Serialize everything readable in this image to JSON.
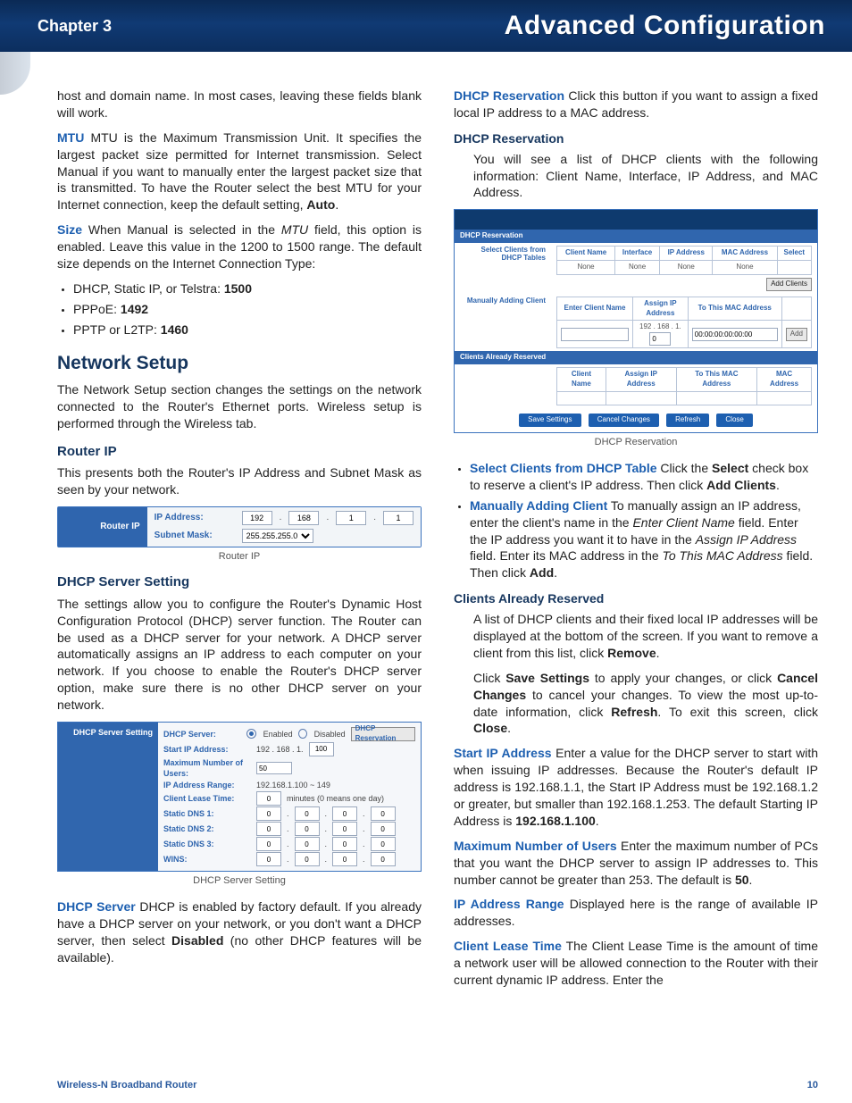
{
  "header": {
    "chapter": "Chapter 3",
    "title": "Advanced Configuration"
  },
  "footer": {
    "left": "Wireless-N Broadband Router",
    "right": "10"
  },
  "p_intro": "host and domain name. In most cases, leaving these fields blank will work.",
  "mtu_term": "MTU",
  "mtu_span_1": " MTU is the Maximum Transmission Unit. It specifies the largest packet size permitted for Internet transmission. Select Manual if you want to manually enter the largest packet size that is transmitted. To have the Router select the best MTU for your Internet connection, keep the default setting, ",
  "mtu_bold_tail": "Auto",
  "mtu_tail": ".",
  "size_term": "Size",
  "size_span_1": " When Manual is selected in the ",
  "size_ital": "MTU",
  "size_span_2": " field, this option is enabled. Leave this value in the 1200 to 1500 range. The default size depends on the Internet Connection Type:",
  "size_list": [
    {
      "pre": "DHCP, Static IP, or Telstra: ",
      "val": "1500"
    },
    {
      "pre": "PPPoE: ",
      "val": "1492"
    },
    {
      "pre": "PPTP or L2TP: ",
      "val": "1460"
    }
  ],
  "sec_network_setup": "Network Setup",
  "ns_intro": "The Network Setup section changes the settings on the network connected to the Router's Ethernet ports. Wireless setup is performed through the Wireless tab.",
  "sub_routerip": "Router IP",
  "routerip_text": "This presents both the Router's IP Address and Subnet Mask as seen by your network.",
  "fig_routerip": {
    "side": "Router IP",
    "ip_label": "IP Address:",
    "ip": [
      "192",
      "168",
      "1",
      "1"
    ],
    "mask_label": "Subnet Mask:",
    "mask": "255.255.255.0",
    "caption": "Router IP"
  },
  "sub_dhcp_setting": "DHCP Server Setting",
  "dhcp_setting_text": "The settings allow you to configure the Router's Dynamic Host Configuration Protocol (DHCP) server function. The Router can be used as a DHCP server for your network. A DHCP server automatically assigns an IP address to each computer on your network. If you choose to enable the Router's DHCP server option, make sure there is no other DHCP server on your network.",
  "fig_dhcp": {
    "side": "DHCP Server Setting",
    "labels": {
      "server": "DHCP Server:",
      "enabled": "Enabled",
      "disabled": "Disabled",
      "reservation_btn": "DHCP Reservation",
      "start_ip": "Start IP Address:",
      "start_ip_prefix": "192 . 168 . 1.",
      "start_ip_val": "100",
      "max_users": "Maximum Number of Users:",
      "max_users_val": "50",
      "range": "IP Address Range:",
      "range_val": "192.168.1.100 ~ 149",
      "lease": "Client Lease Time:",
      "lease_val": "0",
      "lease_hint": "minutes (0 means one day)",
      "dns1": "Static DNS 1:",
      "dns2": "Static DNS 2:",
      "dns3": "Static DNS 3:",
      "wins": "WINS:"
    },
    "caption": "DHCP Server Setting"
  },
  "dhcp_server_term": "DHCP Server",
  "dhcp_server_span_1": " DHCP is enabled by factory default. If you already have a DHCP server on your network, or you don't want a DHCP server, then select ",
  "dhcp_server_bold": "Disabled",
  "dhcp_server_span_2": " (no other DHCP features will be available).",
  "dhcp_res_term": "DHCP Reservation",
  "dhcp_res_text": " Click this button if you want to assign a fixed local IP address to a MAC address.",
  "sub_dhcp_reservation": "DHCP Reservation",
  "dhcp_reservation_intro": "You will see a list of DHCP clients with the following information: Client Name, Interface, IP Address, and MAC Address.",
  "fig_res": {
    "strip": "DHCP Reservation",
    "side1": "Select Clients from DHCP Tables",
    "th": [
      "Client Name",
      "Interface",
      "IP Address",
      "MAC Address",
      "Select"
    ],
    "td_none": "None",
    "add_clients": "Add Clients",
    "side2": "Manually Adding Client",
    "man_th": [
      "Enter Client Name",
      "Assign IP Address",
      "To This MAC Address"
    ],
    "man_ip_prefix": "192 . 168 . 1.",
    "man_ip_val": "0",
    "man_mac": "00:00:00:00:00:00",
    "add_btn": "Add",
    "side3_strip": "Clients Already Reserved",
    "res_th": [
      "Client Name",
      "Assign IP Address",
      "To This MAC Address",
      "MAC Address"
    ],
    "buttons": [
      "Save Settings",
      "Cancel Changes",
      "Refresh",
      "Close"
    ],
    "caption": "DHCP Reservation"
  },
  "bl_select_term": "Select Clients from DHCP Table",
  "bl_select_1": " Click the ",
  "bl_select_bold1": "Select",
  "bl_select_2": " check box to reserve a client's IP address. Then click ",
  "bl_select_bold2": "Add Clients",
  "bl_select_3": ".",
  "bl_manual_term": "Manually Adding Client",
  "bl_manual_1": " To manually assign an IP address, enter the client's name in the ",
  "bl_manual_i1": "Enter Client Name",
  "bl_manual_2": " field. Enter the IP address you want it to have in the ",
  "bl_manual_i2": "Assign IP Address",
  "bl_manual_3": " field. Enter its MAC address in the ",
  "bl_manual_i3": "To This MAC Address",
  "bl_manual_4": " field. Then click ",
  "bl_manual_bold": "Add",
  "bl_manual_5": ".",
  "sub_clients_reserved": "Clients Already Reserved",
  "car_p1_a": "A list of DHCP clients and their fixed local IP addresses will be displayed at the bottom of the screen. If you want to remove a client from this list, click ",
  "car_p1_b": "Remove",
  "car_p1_c": ".",
  "car_p2_a": "Click ",
  "car_p2_b": "Save Settings",
  "car_p2_c": " to apply your changes, or click ",
  "car_p2_d": "Cancel Changes",
  "car_p2_e": " to cancel your changes. To view the most up-to-date information, click ",
  "car_p2_f": "Refresh",
  "car_p2_g": ". To exit this screen, click ",
  "car_p2_h": "Close",
  "car_p2_i": ".",
  "startip_term": "Start IP Address",
  "startip_1": " Enter a value for the DHCP server to start with when issuing IP addresses. Because the Router's default IP address is 192.168.1.1, the Start IP Address must be 192.168.1.2 or greater, but smaller than 192.168.1.253. The default Starting IP Address is ",
  "startip_bold": "192.168.1.100",
  "startip_2": ".",
  "maxusers_term": "Maximum Number of Users",
  "maxusers_1": " Enter the maximum number of PCs that you want the DHCP server to assign IP addresses to. This number cannot be greater than 253. The default is ",
  "maxusers_bold": "50",
  "maxusers_2": ".",
  "iprange_term": "IP Address Range",
  "iprange_text": " Displayed here is the range of available IP addresses.",
  "lease_term": "Client Lease Time",
  "lease_text": " The Client Lease Time is the amount of time a network user will be allowed connection to the Router with their current dynamic IP address. Enter the"
}
